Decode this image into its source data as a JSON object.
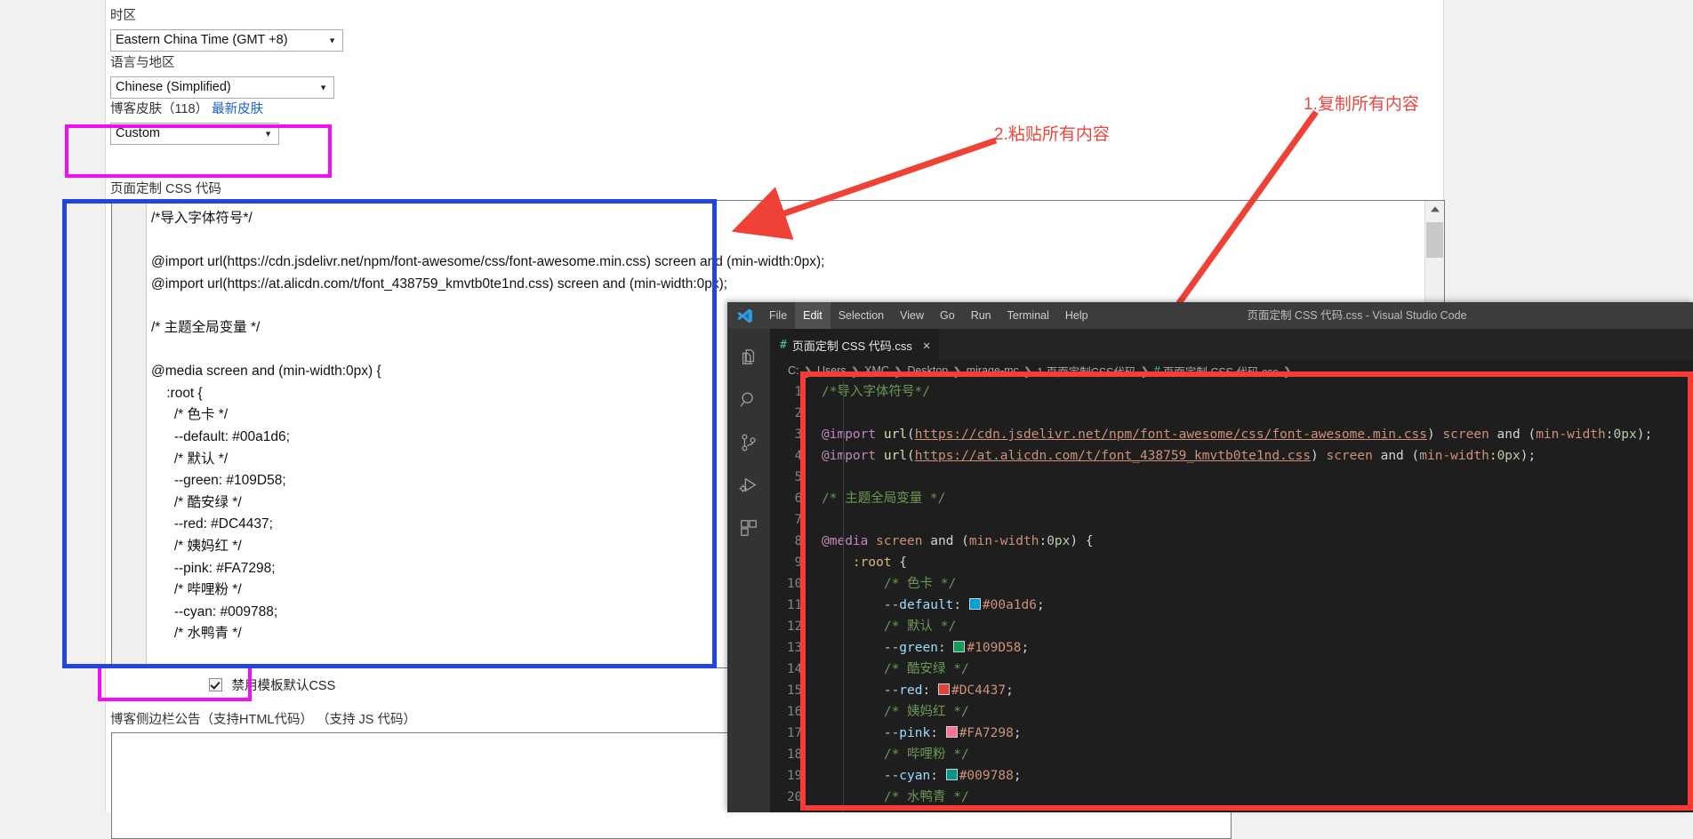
{
  "form": {
    "timezone": {
      "label": "时区",
      "value": "Eastern China Time (GMT +8)",
      "arrow": "▼"
    },
    "language": {
      "label": "语言与地区",
      "value": "Chinese (Simplified)",
      "arrow": "▼"
    },
    "skin": {
      "label_main": "博客皮肤（118）",
      "label_link": "最新皮肤",
      "value": "Custom",
      "arrow": "▼"
    },
    "css_code": {
      "label": "页面定制 CSS 代码",
      "content": "/*导入字体符号*/\n\n@import url(https://cdn.jsdelivr.net/npm/font-awesome/css/font-awesome.min.css) screen and (min-width:0px);\n@import url(https://at.alicdn.com/t/font_438759_kmvtb0te1nd.css) screen and (min-width:0px);\n\n/* 主题全局变量 */\n\n@media screen and (min-width:0px) {\n    :root {\n      /* 色卡 */\n      --default: #00a1d6;\n      /* 默认 */\n      --green: #109D58;\n      /* 酷安绿 */\n      --red: #DC4437;\n      /* 姨妈红 */\n      --pink: #FA7298;\n      /* 哔哩粉 */\n      --cyan: #009788;\n      /* 水鸭青 */"
    },
    "disable_default_css": {
      "label": "禁用模板默认CSS",
      "checked": true
    },
    "sidebar_notice": {
      "label": "博客侧边栏公告（支持HTML代码）    （支持 JS 代码）",
      "value": ""
    }
  },
  "annotations": [
    {
      "id": "annot-1",
      "text": "1.复制所有内容"
    },
    {
      "id": "annot-2",
      "text": "2.粘贴所有内容"
    }
  ],
  "highlight_colors": {
    "magenta": "#f40cf4",
    "blue": "#2244e0",
    "red": "#fb3b36"
  },
  "vscode": {
    "window_title": "页面定制 CSS 代码.css - Visual Studio Code",
    "menu": [
      "File",
      "Edit",
      "Selection",
      "View",
      "Go",
      "Run",
      "Terminal",
      "Help"
    ],
    "menu_active": "Edit",
    "activity_bar": [
      "explorer-icon",
      "search-icon",
      "source-control-icon",
      "run-debug-icon",
      "extensions-icon"
    ],
    "tab": {
      "hash": "#",
      "title": "页面定制 CSS 代码.css",
      "close": "✕"
    },
    "breadcrumb": [
      "C:",
      "Users",
      "XMC",
      "Desktop",
      "mirage-mc",
      "1.页面定制CSS代码",
      "页面定制 CSS 代码.css",
      "..."
    ],
    "code_lines": [
      {
        "n": "1",
        "tokens": [
          {
            "t": "comment",
            "v": "/*导入字体符号*/"
          }
        ]
      },
      {
        "n": "2",
        "tokens": []
      },
      {
        "n": "3",
        "tokens": [
          {
            "t": "atrule",
            "v": "@import "
          },
          {
            "t": "fn",
            "v": "url"
          },
          {
            "t": "punc",
            "v": "("
          },
          {
            "t": "url",
            "v": "https://cdn.jsdelivr.net/npm/font-awesome/css/font-awesome.min.css"
          },
          {
            "t": "punc",
            "v": ") "
          },
          {
            "t": "kw",
            "v": "screen"
          },
          {
            "t": "txt",
            "v": " and "
          },
          {
            "t": "punc",
            "v": "("
          },
          {
            "t": "kw",
            "v": "min-width"
          },
          {
            "t": "punc",
            "v": ":"
          },
          {
            "t": "num",
            "v": "0px"
          },
          {
            "t": "punc",
            "v": ");"
          }
        ]
      },
      {
        "n": "4",
        "tokens": [
          {
            "t": "atrule",
            "v": "@import "
          },
          {
            "t": "fn",
            "v": "url"
          },
          {
            "t": "punc",
            "v": "("
          },
          {
            "t": "url",
            "v": "https://at.alicdn.com/t/font_438759_kmvtb0te1nd.css"
          },
          {
            "t": "punc",
            "v": ") "
          },
          {
            "t": "kw",
            "v": "screen"
          },
          {
            "t": "txt",
            "v": " and "
          },
          {
            "t": "punc",
            "v": "("
          },
          {
            "t": "kw",
            "v": "min-width"
          },
          {
            "t": "punc",
            "v": ":"
          },
          {
            "t": "num",
            "v": "0px"
          },
          {
            "t": "punc",
            "v": ");"
          }
        ]
      },
      {
        "n": "5",
        "tokens": []
      },
      {
        "n": "6",
        "tokens": [
          {
            "t": "comment",
            "v": "/* 主题全局变量 */"
          }
        ]
      },
      {
        "n": "7",
        "tokens": []
      },
      {
        "n": "8",
        "tokens": [
          {
            "t": "atrule",
            "v": "@media "
          },
          {
            "t": "kw",
            "v": "screen"
          },
          {
            "t": "txt",
            "v": " and "
          },
          {
            "t": "punc",
            "v": "("
          },
          {
            "t": "kw",
            "v": "min-width"
          },
          {
            "t": "punc",
            "v": ":"
          },
          {
            "t": "num",
            "v": "0px"
          },
          {
            "t": "punc",
            "v": ") {"
          }
        ]
      },
      {
        "n": "9",
        "tokens": [
          {
            "t": "txt",
            "v": "    "
          },
          {
            "t": "sel",
            "v": ":root"
          },
          {
            "t": "punc",
            "v": " {"
          }
        ]
      },
      {
        "n": "10",
        "tokens": [
          {
            "t": "txt",
            "v": "        "
          },
          {
            "t": "comment",
            "v": "/* 色卡 */"
          }
        ]
      },
      {
        "n": "11",
        "tokens": [
          {
            "t": "txt",
            "v": "        "
          },
          {
            "t": "var",
            "v": "--default"
          },
          {
            "t": "punc",
            "v": ": "
          },
          {
            "t": "swatch",
            "v": "#00a1d6"
          },
          {
            "t": "str",
            "v": "#00a1d6"
          },
          {
            "t": "punc",
            "v": ";"
          }
        ]
      },
      {
        "n": "12",
        "tokens": [
          {
            "t": "txt",
            "v": "        "
          },
          {
            "t": "comment",
            "v": "/* 默认 */"
          }
        ]
      },
      {
        "n": "13",
        "tokens": [
          {
            "t": "txt",
            "v": "        "
          },
          {
            "t": "var",
            "v": "--green"
          },
          {
            "t": "punc",
            "v": ": "
          },
          {
            "t": "swatch",
            "v": "#109D58"
          },
          {
            "t": "str",
            "v": "#109D58"
          },
          {
            "t": "punc",
            "v": ";"
          }
        ]
      },
      {
        "n": "14",
        "tokens": [
          {
            "t": "txt",
            "v": "        "
          },
          {
            "t": "comment",
            "v": "/* 酷安绿 */"
          }
        ]
      },
      {
        "n": "15",
        "tokens": [
          {
            "t": "txt",
            "v": "        "
          },
          {
            "t": "var",
            "v": "--red"
          },
          {
            "t": "punc",
            "v": ": "
          },
          {
            "t": "swatch",
            "v": "#DC4437"
          },
          {
            "t": "str",
            "v": "#DC4437"
          },
          {
            "t": "punc",
            "v": ";"
          }
        ]
      },
      {
        "n": "16",
        "tokens": [
          {
            "t": "txt",
            "v": "        "
          },
          {
            "t": "comment",
            "v": "/* 姨妈红 */"
          }
        ]
      },
      {
        "n": "17",
        "tokens": [
          {
            "t": "txt",
            "v": "        "
          },
          {
            "t": "var",
            "v": "--pink"
          },
          {
            "t": "punc",
            "v": ": "
          },
          {
            "t": "swatch",
            "v": "#FA7298"
          },
          {
            "t": "str",
            "v": "#FA7298"
          },
          {
            "t": "punc",
            "v": ";"
          }
        ]
      },
      {
        "n": "18",
        "tokens": [
          {
            "t": "txt",
            "v": "        "
          },
          {
            "t": "comment",
            "v": "/* 哔哩粉 */"
          }
        ]
      },
      {
        "n": "19",
        "tokens": [
          {
            "t": "txt",
            "v": "        "
          },
          {
            "t": "var",
            "v": "--cyan"
          },
          {
            "t": "punc",
            "v": ": "
          },
          {
            "t": "swatch",
            "v": "#009788"
          },
          {
            "t": "str",
            "v": "#009788"
          },
          {
            "t": "punc",
            "v": ";"
          }
        ]
      },
      {
        "n": "20",
        "tokens": [
          {
            "t": "txt",
            "v": "        "
          },
          {
            "t": "comment",
            "v": "/* 水鸭青 */"
          }
        ]
      }
    ]
  }
}
